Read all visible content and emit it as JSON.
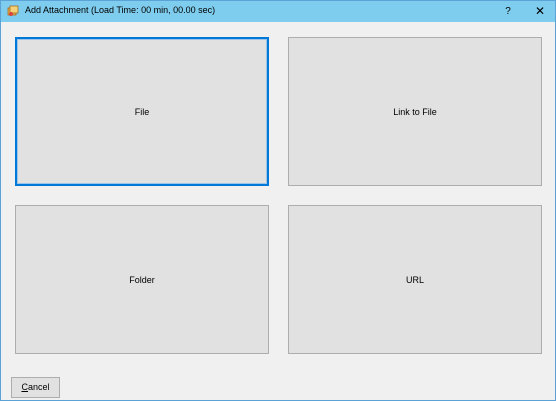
{
  "window": {
    "title": "Add Attachment (Load Time: 00 min, 00.00 sec)",
    "help_label": "?",
    "close_label": "✕"
  },
  "buttons": {
    "file": "File",
    "link_to_file": "Link to File",
    "folder": "Folder",
    "url": "URL"
  },
  "footer": {
    "cancel_accel": "C",
    "cancel_rest": "ancel"
  },
  "icons": {
    "app": "attachment-app-icon"
  },
  "colors": {
    "titlebar": "#7fcdee",
    "focus": "#0078d7"
  }
}
